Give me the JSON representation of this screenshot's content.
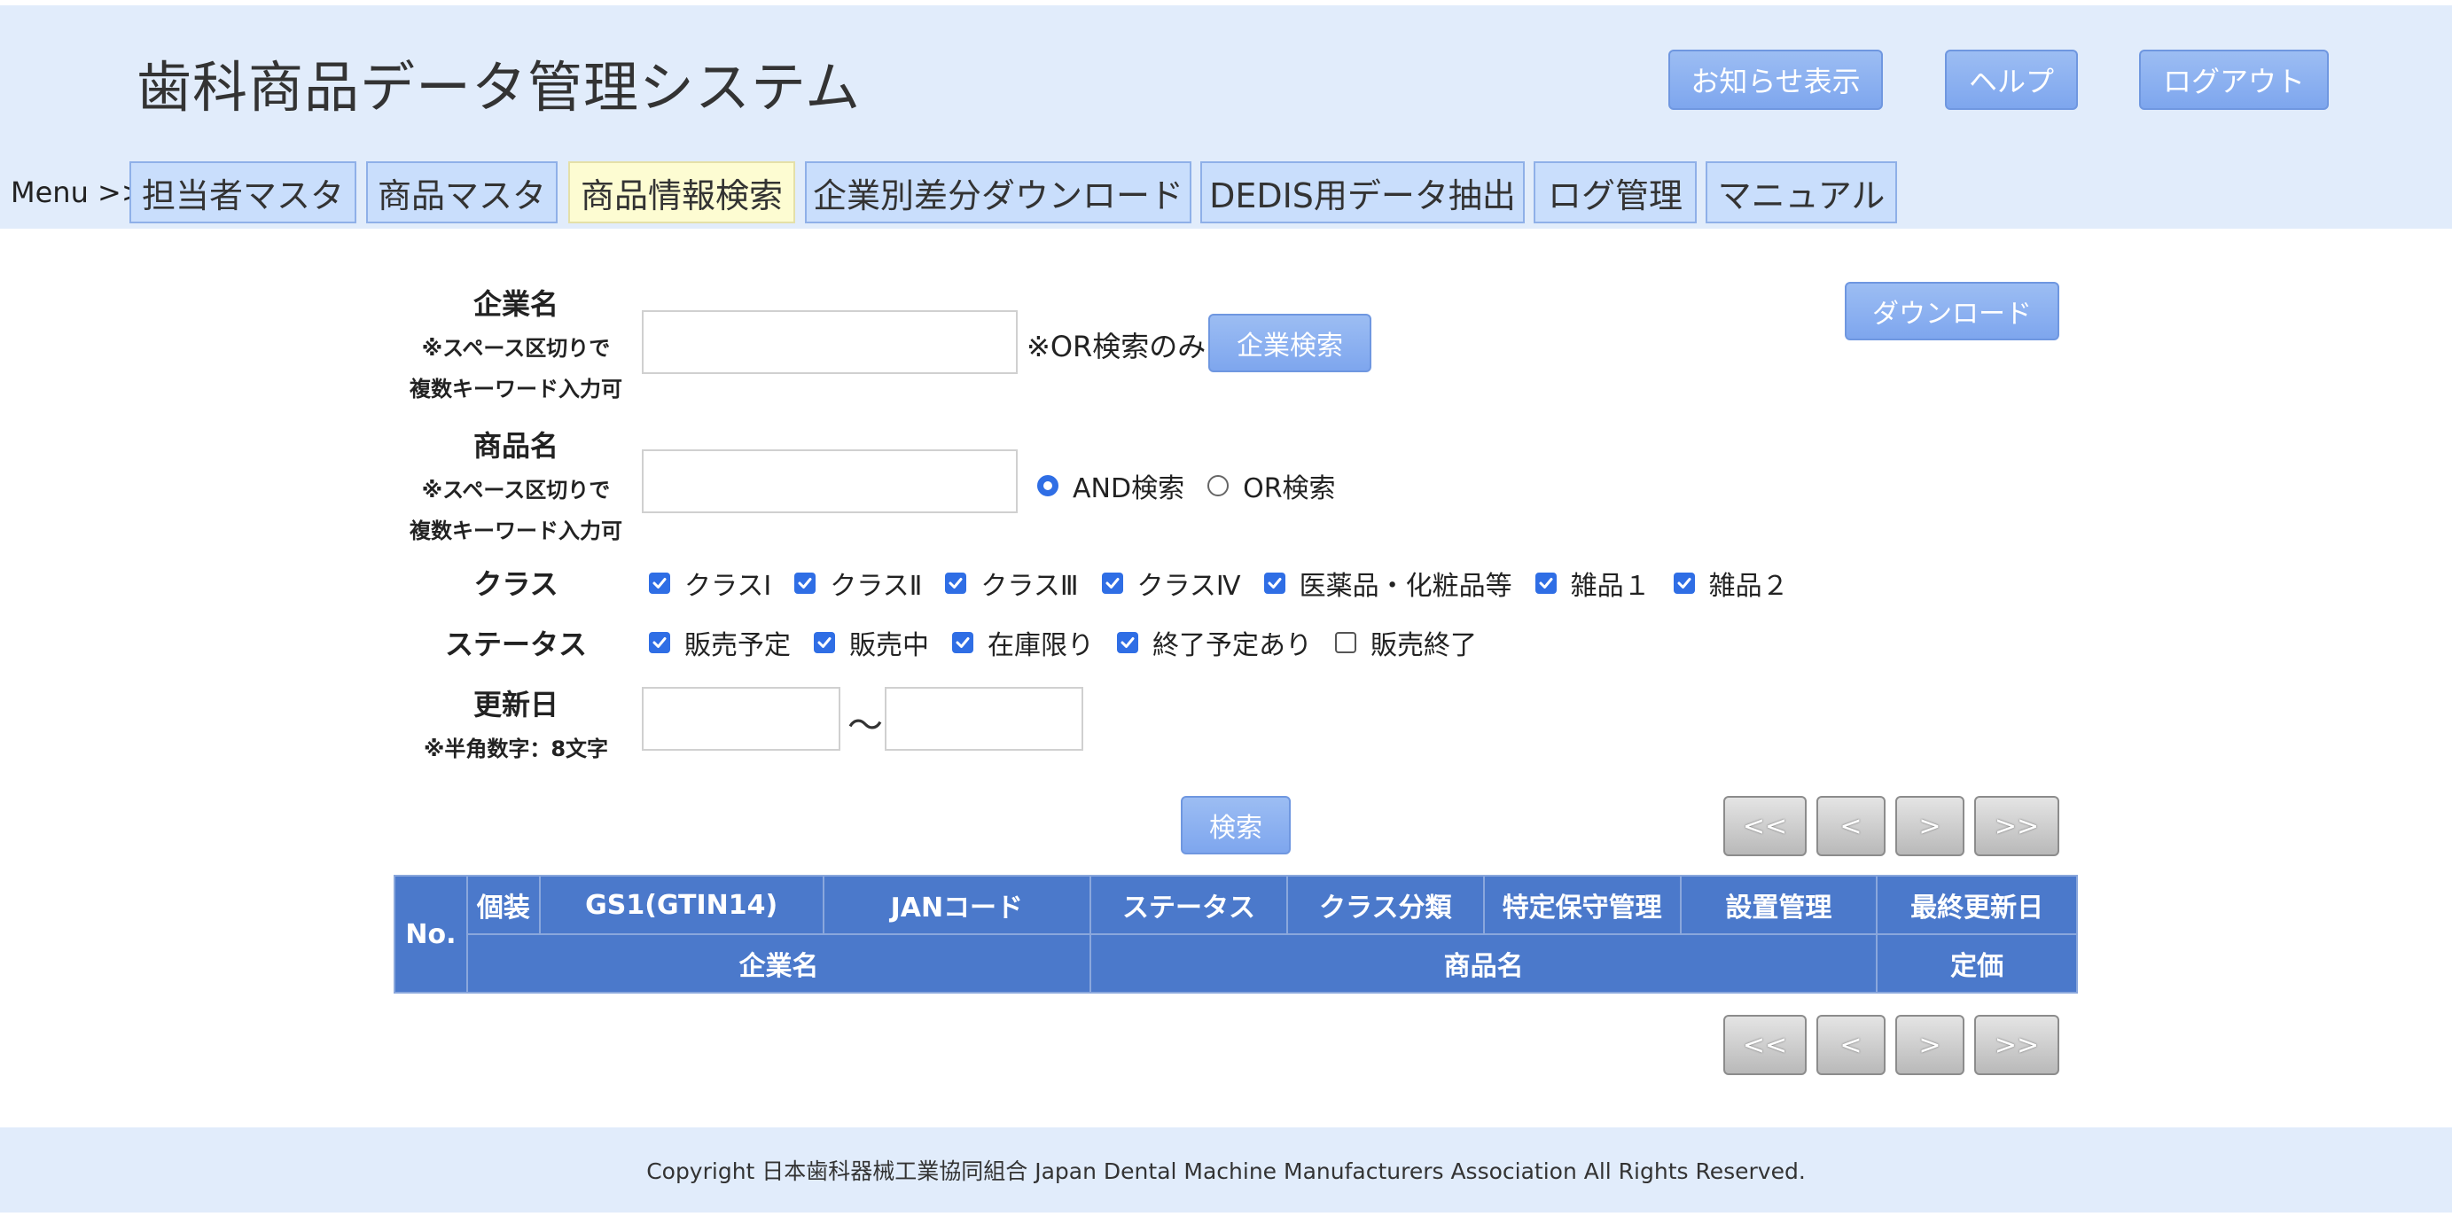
{
  "header": {
    "title": "歯科商品データ管理システム",
    "buttons": {
      "notice": "お知らせ表示",
      "help": "ヘルプ",
      "logout": "ログアウト"
    },
    "menu_label": "Menu >>",
    "menu": [
      {
        "label": "担当者マスタ",
        "active": false
      },
      {
        "label": "商品マスタ",
        "active": false
      },
      {
        "label": "商品情報検索",
        "active": true
      },
      {
        "label": "企業別差分ダウンロード",
        "active": false
      },
      {
        "label": "DEDIS用データ抽出",
        "active": false
      },
      {
        "label": "ログ管理",
        "active": false
      },
      {
        "label": "マニュアル",
        "active": false
      }
    ]
  },
  "form": {
    "download_label": "ダウンロード",
    "company": {
      "label": "企業名",
      "sub1": "※スペース区切りで",
      "sub2": "複数キーワード入力可",
      "value": "",
      "note": "※OR検索のみ",
      "button": "企業検索"
    },
    "product": {
      "label": "商品名",
      "sub1": "※スペース区切りで",
      "sub2": "複数キーワード入力可",
      "value": "",
      "modes": [
        {
          "label": "AND検索",
          "selected": true
        },
        {
          "label": "OR検索",
          "selected": false
        }
      ]
    },
    "class": {
      "label": "クラス",
      "options": [
        {
          "label": "クラスⅠ",
          "checked": true
        },
        {
          "label": "クラスⅡ",
          "checked": true
        },
        {
          "label": "クラスⅢ",
          "checked": true
        },
        {
          "label": "クラスⅣ",
          "checked": true
        },
        {
          "label": "医薬品・化粧品等",
          "checked": true
        },
        {
          "label": "雑品１",
          "checked": true
        },
        {
          "label": "雑品２",
          "checked": true
        }
      ]
    },
    "status": {
      "label": "ステータス",
      "options": [
        {
          "label": "販売予定",
          "checked": true
        },
        {
          "label": "販売中",
          "checked": true
        },
        {
          "label": "在庫限り",
          "checked": true
        },
        {
          "label": "終了予定あり",
          "checked": true
        },
        {
          "label": "販売終了",
          "checked": false
        }
      ]
    },
    "updated": {
      "label": "更新日",
      "sub": "※半角数字：8文字",
      "from": "",
      "to": "",
      "separator": "〜"
    },
    "search_button": "検索"
  },
  "pagination": {
    "first": "<<",
    "prev": "<",
    "next": ">",
    "last": ">>"
  },
  "table": {
    "no": "No.",
    "row1": [
      "個装",
      "GS1(GTIN14)",
      "JANコード",
      "ステータス",
      "クラス分類",
      "特定保守管理",
      "設置管理",
      "最終更新日"
    ],
    "row2": [
      "企業名",
      "商品名",
      "定価"
    ]
  },
  "footer": {
    "copyright": "Copyright 日本歯科器械工業協同組合 Japan Dental Machine Manufacturers Association All Rights Reserved."
  }
}
